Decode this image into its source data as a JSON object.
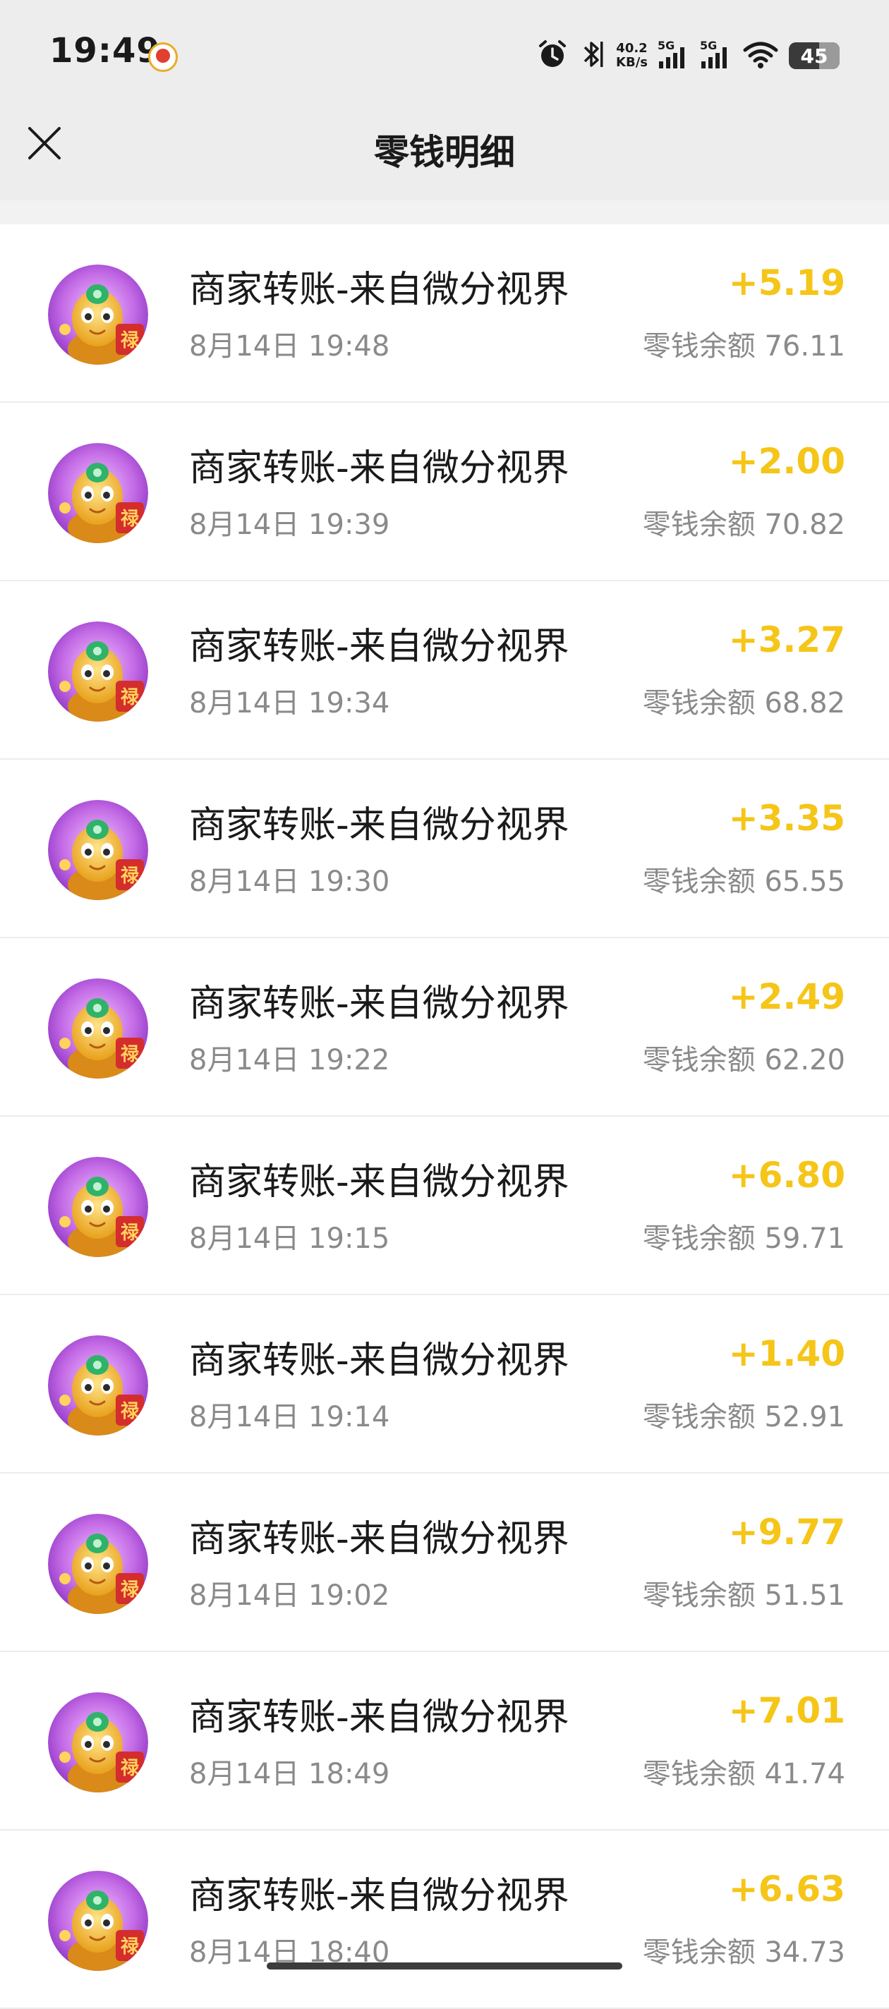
{
  "status_bar": {
    "time": "19:49",
    "net_speed_value": "40.2",
    "net_speed_unit": "KB/s",
    "signal1_label": "5G",
    "signal2_label": "5G",
    "battery": "45",
    "icons": [
      "app-notification-icon",
      "alarm-icon",
      "bluetooth-icon",
      "signal-icon",
      "signal-icon",
      "wifi-icon",
      "battery-icon"
    ]
  },
  "header": {
    "title": "零钱明细",
    "close_icon": "close-icon"
  },
  "colors": {
    "amount": "#f5c518",
    "background": "#ededed",
    "secondary_text": "#8a8a8a"
  },
  "transactions": [
    {
      "title": "商家转账-来自微分视界",
      "date": "8月14日 19:48",
      "amount": "+5.19",
      "balance": "零钱余额 76.11"
    },
    {
      "title": "商家转账-来自微分视界",
      "date": "8月14日 19:39",
      "amount": "+2.00",
      "balance": "零钱余额 70.82"
    },
    {
      "title": "商家转账-来自微分视界",
      "date": "8月14日 19:34",
      "amount": "+3.27",
      "balance": "零钱余额 68.82"
    },
    {
      "title": "商家转账-来自微分视界",
      "date": "8月14日 19:30",
      "amount": "+3.35",
      "balance": "零钱余额 65.55"
    },
    {
      "title": "商家转账-来自微分视界",
      "date": "8月14日 19:22",
      "amount": "+2.49",
      "balance": "零钱余额 62.20"
    },
    {
      "title": "商家转账-来自微分视界",
      "date": "8月14日 19:15",
      "amount": "+6.80",
      "balance": "零钱余额 59.71"
    },
    {
      "title": "商家转账-来自微分视界",
      "date": "8月14日 19:14",
      "amount": "+1.40",
      "balance": "零钱余额 52.91"
    },
    {
      "title": "商家转账-来自微分视界",
      "date": "8月14日 19:02",
      "amount": "+9.77",
      "balance": "零钱余额 51.51"
    },
    {
      "title": "商家转账-来自微分视界",
      "date": "8月14日 18:49",
      "amount": "+7.01",
      "balance": "零钱余额 41.74"
    },
    {
      "title": "商家转账-来自微分视界",
      "date": "8月14日 18:40",
      "amount": "+6.63",
      "balance": "零钱余额 34.73"
    }
  ]
}
